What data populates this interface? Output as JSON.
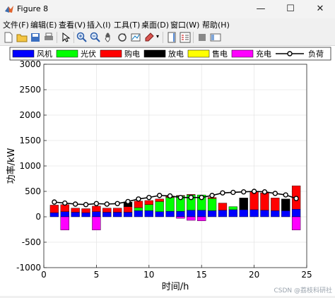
{
  "window": {
    "title": "Figure 8",
    "minimize_glyph": "—",
    "maximize_glyph": "☐",
    "close_glyph": "✕"
  },
  "menu": {
    "items": [
      "文件(F)",
      "编辑(E)",
      "查看(V)",
      "插入(I)",
      "工具(T)",
      "桌面(D)",
      "窗口(W)",
      "帮助(H)"
    ]
  },
  "toolbar": {
    "icons": [
      "new-figure-icon",
      "open-file-icon",
      "save-icon",
      "print-icon",
      "pointer-icon",
      "zoom-in-icon",
      "zoom-out-icon",
      "pan-icon",
      "rotate-icon",
      "data-cursor-icon",
      "brush-icon",
      "colorbar-icon",
      "legend-icon",
      "hide-plot-tools-icon",
      "show-plot-tools-icon"
    ]
  },
  "watermark": "CSDN @荔枝科研社",
  "chart_data": {
    "type": "bar",
    "stacked": true,
    "xlabel": "时间/h",
    "ylabel": "功率/kW",
    "xlim": [
      0,
      25
    ],
    "ylim": [
      -1000,
      3000
    ],
    "xticks": [
      0,
      5,
      10,
      15,
      20,
      25
    ],
    "yticks": [
      -1000,
      -500,
      0,
      500,
      1000,
      1500,
      2000,
      2500,
      3000
    ],
    "grid": true,
    "legend": "top, horizontal, outside axes",
    "x": [
      1,
      2,
      3,
      4,
      5,
      6,
      7,
      8,
      9,
      10,
      11,
      12,
      13,
      14,
      15,
      16,
      17,
      18,
      19,
      20,
      21,
      22,
      23,
      24
    ],
    "series": [
      {
        "name": "风机",
        "color": "#0000ff",
        "values": [
          80,
          100,
          90,
          80,
          100,
          90,
          90,
          90,
          120,
          120,
          100,
          110,
          110,
          130,
          130,
          120,
          130,
          140,
          140,
          140,
          130,
          120,
          120,
          150
        ]
      },
      {
        "name": "光伏",
        "color": "#00ff00",
        "values": [
          0,
          0,
          0,
          0,
          0,
          0,
          0,
          0,
          60,
          120,
          200,
          270,
          300,
          300,
          300,
          240,
          0,
          60,
          0,
          0,
          0,
          0,
          0,
          0
        ]
      },
      {
        "name": "购电",
        "color": "#ff0000",
        "values": [
          150,
          140,
          80,
          80,
          110,
          80,
          80,
          110,
          130,
          80,
          50,
          20,
          10,
          10,
          0,
          20,
          140,
          0,
          0,
          360,
          340,
          250,
          0,
          460
        ]
      },
      {
        "name": "放电",
        "color": "#000000",
        "values": [
          0,
          0,
          0,
          0,
          0,
          0,
          0,
          90,
          0,
          0,
          0,
          0,
          0,
          0,
          0,
          0,
          0,
          0,
          230,
          0,
          0,
          0,
          230,
          0
        ]
      },
      {
        "name": "售电",
        "color": "#ffff00",
        "values": [
          0,
          0,
          0,
          0,
          0,
          0,
          0,
          0,
          0,
          0,
          0,
          0,
          0,
          0,
          0,
          0,
          0,
          0,
          0,
          0,
          0,
          0,
          0,
          0
        ]
      },
      {
        "name": "充电",
        "color": "#ff00ff",
        "values": [
          0,
          -260,
          0,
          0,
          -260,
          0,
          0,
          0,
          0,
          0,
          0,
          0,
          -30,
          -70,
          -80,
          0,
          0,
          0,
          0,
          0,
          0,
          0,
          0,
          -260
        ]
      }
    ],
    "positive_stack_extra": {
      "note_free": true,
      "values": [
        0,
        0,
        0,
        0,
        0,
        0,
        0,
        0,
        0,
        0,
        0,
        0,
        0,
        0,
        0,
        0,
        0,
        0,
        0,
        0,
        0,
        0,
        0,
        0
      ]
    },
    "load": {
      "name": "负荷",
      "color": "#000000",
      "values": [
        290,
        270,
        250,
        240,
        260,
        250,
        260,
        300,
        350,
        380,
        420,
        410,
        380,
        380,
        380,
        420,
        470,
        480,
        490,
        500,
        490,
        460,
        430,
        360
      ]
    }
  }
}
